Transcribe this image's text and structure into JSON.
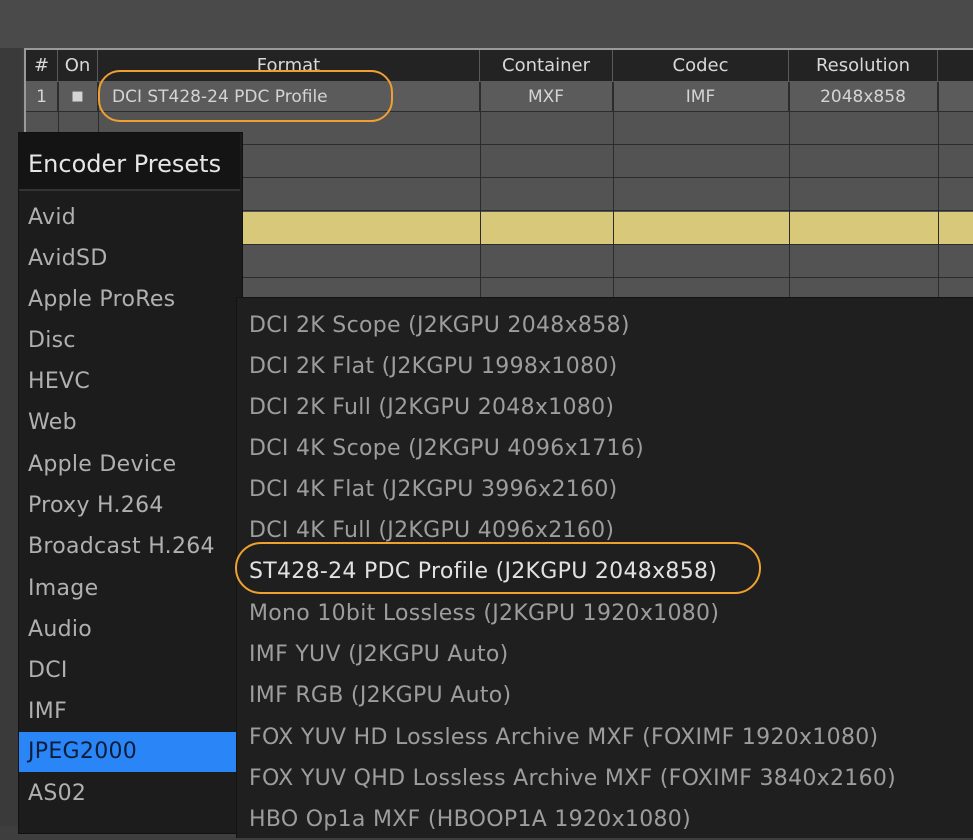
{
  "table": {
    "columns": [
      "#",
      "On",
      "Format",
      "Container",
      "Codec",
      "Resolution",
      ""
    ],
    "rows": [
      {
        "num": "1",
        "on": "■",
        "format": "DCI ST428-24 PDC Profile",
        "container": "MXF",
        "codec": "IMF",
        "resolution": "2048x858"
      }
    ],
    "highlight_color": "#d8c87a"
  },
  "presets_menu": {
    "title": "Encoder Presets",
    "items": [
      "Avid",
      "AvidSD",
      "Apple ProRes",
      "Disc",
      "HEVC",
      "Web",
      "Apple Device",
      "Proxy H.264",
      "Broadcast H.264",
      "Image",
      "Audio",
      "DCI",
      "IMF",
      "JPEG2000",
      "AS02"
    ],
    "active": "JPEG2000",
    "active_color": "#2a86f6"
  },
  "submenu": {
    "items": [
      "DCI 2K Scope  (J2KGPU 2048x858)",
      "DCI 2K Flat  (J2KGPU 1998x1080)",
      "DCI 2K Full  (J2KGPU 2048x1080)",
      "DCI 4K Scope  (J2KGPU 4096x1716)",
      "DCI 4K Flat  (J2KGPU 3996x2160)",
      "DCI 4K Full  (J2KGPU 4096x2160)",
      "ST428-24 PDC Profile  (J2KGPU 2048x858)",
      "Mono 10bit Lossless  (J2KGPU 1920x1080)",
      "IMF YUV  (J2KGPU Auto)",
      "IMF RGB  (J2KGPU Auto)",
      "FOX YUV HD Lossless Archive MXF  (FOXIMF 1920x1080)",
      "FOX YUV QHD Lossless Archive MXF  (FOXIMF 3840x2160)",
      "HBO Op1a MXF  (HBOOP1A 1920x1080)"
    ],
    "selected": "ST428-24 PDC Profile  (J2KGPU 2048x858)"
  },
  "annotation_color": "#f0a030"
}
